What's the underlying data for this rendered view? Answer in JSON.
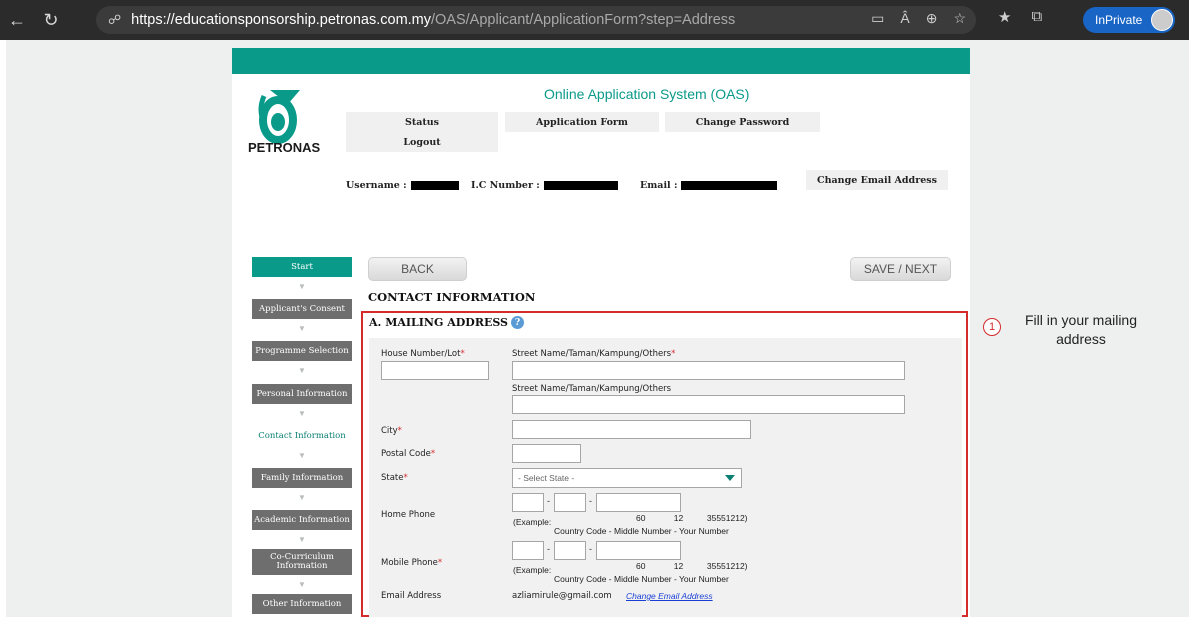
{
  "browser": {
    "url_domain": "https://educationsponsorship.petronas.com.my",
    "url_path": "/OAS/Applicant/ApplicationForm?step=Address",
    "inprivate_label": "InPrivate"
  },
  "header": {
    "logo_text": "PETRONAS",
    "system_title": "Online Application System (OAS)",
    "menu": {
      "status": "Status",
      "application_form": "Application Form",
      "change_password": "Change Password",
      "logout": "Logout"
    },
    "username_label": "Username :",
    "ic_label": "I.C Number :",
    "email_label": "Email :",
    "change_email_button": "Change Email Address"
  },
  "sidebar": {
    "steps": [
      "Start",
      "Applicant's Consent",
      "Programme Selection",
      "Personal Information",
      "Contact Information",
      "Family Information",
      "Academic Information",
      "Co-Curriculum Information",
      "Other Information"
    ],
    "active_step": "Contact Information"
  },
  "buttons": {
    "back": "BACK",
    "save_next": "SAVE / NEXT"
  },
  "form": {
    "section_title": "CONTACT INFORMATION",
    "subsection_title": "A. MAILING ADDRESS",
    "house_label": "House Number/Lot",
    "street_label": "Street Name/Taman/Kampung/Others",
    "street2_label": "Street Name/Taman/Kampung/Others",
    "city_label": "City",
    "postal_label": "Postal Code",
    "state_label": "State",
    "state_value": "- Select State -",
    "home_phone_label": "Home Phone",
    "mobile_phone_label": "Mobile Phone",
    "example_prefix": "(Example:",
    "example_values": "60            12          35551212)",
    "example_caption": "Country Code - Middle Number - Your Number",
    "email_label": "Email Address",
    "email_value": "azliamirule@gmail.com",
    "change_email_link": "Change Email Address",
    "required_mark": "*"
  },
  "annotation": {
    "number": "1",
    "text": "Fill in your mailing address"
  },
  "colors": {
    "teal": "#0a9a8a",
    "required": "#d42b2b",
    "highlight_border": "#d42b2b"
  }
}
